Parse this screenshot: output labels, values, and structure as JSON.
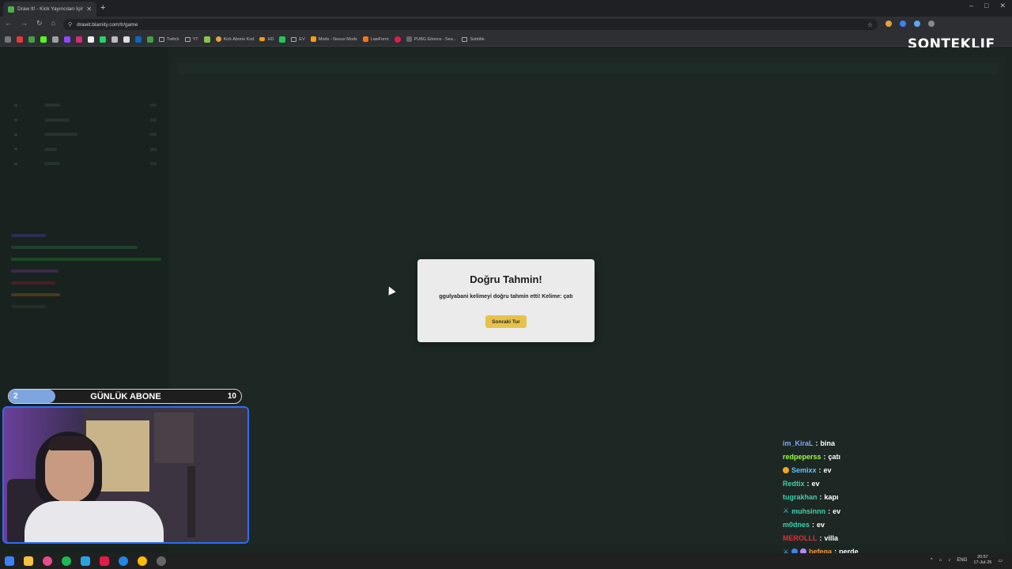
{
  "browser": {
    "tab_title": "Draw It! - Kick Yayıncıları İçin Çiz...",
    "url": "drawit.blamity.com/tr/game",
    "bookmarks": [
      "Twitch",
      "YT",
      "Kick Abone Kod",
      "HD",
      "EV",
      "Mods - Nexus Mods",
      "LawForm",
      "PUBG Elmora - Sea...",
      "Subtitle"
    ]
  },
  "overlay": {
    "logo": "SONTEKLIF"
  },
  "modal": {
    "title": "Doğru Tahmin!",
    "message": "ggulyabani kelimeyi doğru tahmin etti! Kelime: çatı",
    "button": "Sonraki Tur"
  },
  "sub_goal": {
    "current": "2",
    "label": "GÜNLÜK ABONE",
    "goal": "10",
    "progress_fraction": 0.2
  },
  "stream_chat": [
    {
      "user": "im_KiraL",
      "text": "bina",
      "color": "#7aa9ff"
    },
    {
      "user": "redpeperss",
      "text": "çatı",
      "color": "#9dff3a"
    },
    {
      "user": "Semixx",
      "text": "ev",
      "color": "#5fc0ff"
    },
    {
      "user": "Redtix",
      "text": "ev",
      "color": "#3ecfae"
    },
    {
      "user": "tugrakhan",
      "text": "kapı",
      "color": "#3ecfae"
    },
    {
      "user": "muhsinnn",
      "text": "ev",
      "color": "#3ecfae"
    },
    {
      "user": "m0dnes",
      "text": "ev",
      "color": "#3ecfae"
    },
    {
      "user": "MEROLLL",
      "text": "villa",
      "color": "#e0303a"
    },
    {
      "user": "befega",
      "text": "perde",
      "color": "#ff9a3c"
    }
  ],
  "taskbar": {
    "lang": "ENG",
    "time": "20:57",
    "date": "17-Jul-25"
  }
}
